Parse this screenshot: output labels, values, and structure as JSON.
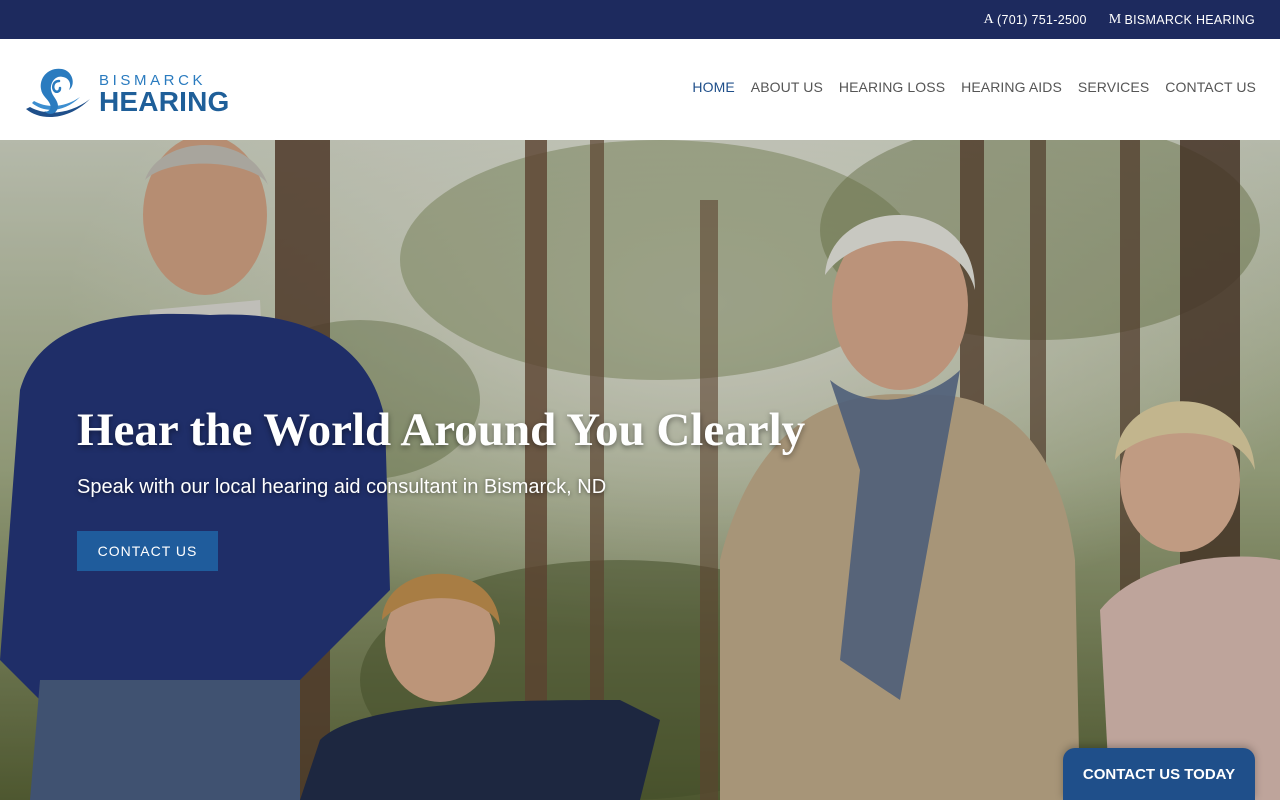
{
  "topbar": {
    "phone_glyph": "A",
    "phone": "(701) 751-2500",
    "map_glyph": "M",
    "location": "BISMARCK HEARING"
  },
  "logo": {
    "top": "BISMARCK",
    "bottom": "HEARING"
  },
  "nav": {
    "items": [
      {
        "label": "HOME"
      },
      {
        "label": "ABOUT US"
      },
      {
        "label": "HEARING LOSS"
      },
      {
        "label": "HEARING AIDS"
      },
      {
        "label": "SERVICES"
      },
      {
        "label": "CONTACT US"
      }
    ],
    "active": "HOME"
  },
  "hero": {
    "title": "Hear the World Around You Clearly",
    "subtitle": "Speak with our local hearing aid consultant in Bismarck, ND",
    "button_label": "CONTACT US",
    "image_icon": "family-walking-in-forest-photo"
  },
  "floating_cta": {
    "label": "CONTACT US TODAY"
  },
  "colors": {
    "topbar_bg": "#1d2a5e",
    "brand_blue": "#1f5f99",
    "button_blue": "#1f5c9c",
    "nav_active": "#1f4f8a"
  }
}
